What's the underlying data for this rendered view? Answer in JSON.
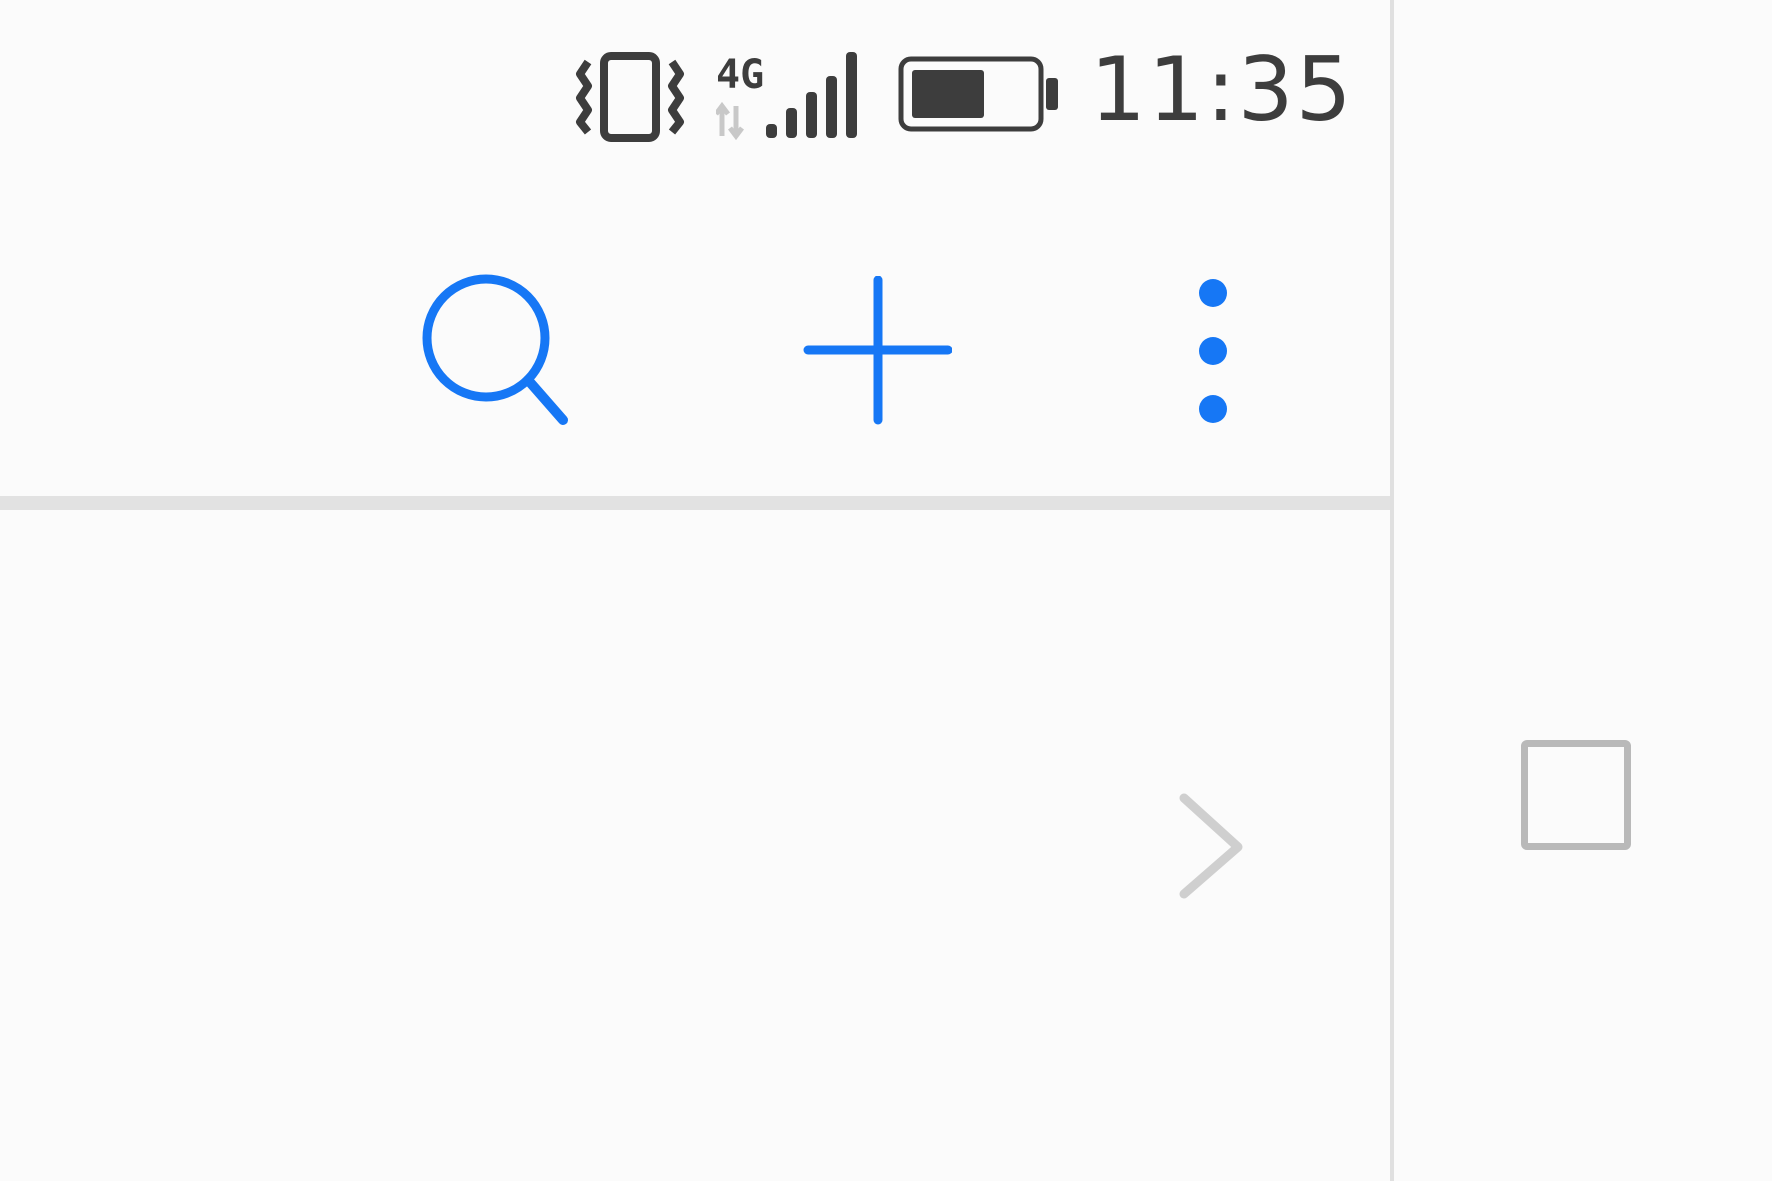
{
  "status_bar": {
    "time": "11:35",
    "network_type": "4G",
    "icons": [
      "vibrate-icon",
      "signal-4g-icon",
      "battery-icon"
    ],
    "battery_level": 0.6,
    "color": "#3d3d3d"
  },
  "toolbar": {
    "icons": [
      "search-icon",
      "add-icon",
      "more-options-icon"
    ],
    "accent_color": "#1677f5"
  },
  "list": {
    "row_icon": "chevron-right-icon",
    "chevron_color": "#cfcfcf"
  },
  "side_pane": {
    "checkbox_icon": "checkbox-icon",
    "checked": false,
    "checkbox_color": "#b9b9b9"
  }
}
